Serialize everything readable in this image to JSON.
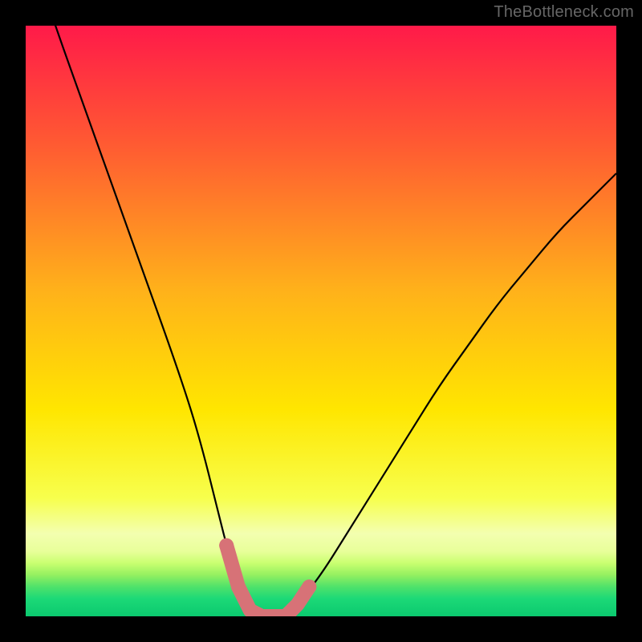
{
  "watermark": "TheBottleneck.com",
  "chart_data": {
    "type": "line",
    "title": "",
    "xlabel": "",
    "ylabel": "",
    "xlim": [
      0,
      100
    ],
    "ylim": [
      0,
      100
    ],
    "series": [
      {
        "name": "bottleneck-curve",
        "x": [
          0,
          5,
          10,
          15,
          20,
          25,
          28,
          30,
          32,
          34,
          36,
          38,
          40,
          42,
          44,
          46,
          50,
          55,
          60,
          65,
          70,
          75,
          80,
          85,
          90,
          95,
          100
        ],
        "values": [
          115,
          100,
          86,
          72,
          58,
          44,
          35,
          28,
          20,
          12,
          5,
          1,
          0,
          0,
          0,
          2,
          7,
          15,
          23,
          31,
          39,
          46,
          53,
          59,
          65,
          70,
          75
        ]
      }
    ],
    "highlight": {
      "name": "optimal-range",
      "color": "#d77277",
      "x": [
        34,
        36,
        38,
        40,
        42,
        44,
        46,
        48
      ],
      "values": [
        12,
        5,
        1,
        0,
        0,
        0,
        2,
        5
      ]
    },
    "gradient_stops": [
      {
        "pct": 0,
        "color": "#ff1a49"
      },
      {
        "pct": 20,
        "color": "#ff5a32"
      },
      {
        "pct": 45,
        "color": "#ffb21a"
      },
      {
        "pct": 65,
        "color": "#ffe600"
      },
      {
        "pct": 80,
        "color": "#f7ff4d"
      },
      {
        "pct": 86,
        "color": "#f3ffb0"
      },
      {
        "pct": 89,
        "color": "#e8ff9a"
      },
      {
        "pct": 91,
        "color": "#c9ff70"
      },
      {
        "pct": 93,
        "color": "#94f060"
      },
      {
        "pct": 95,
        "color": "#4fe26a"
      },
      {
        "pct": 97,
        "color": "#1cd977"
      },
      {
        "pct": 100,
        "color": "#0bc96f"
      }
    ]
  }
}
